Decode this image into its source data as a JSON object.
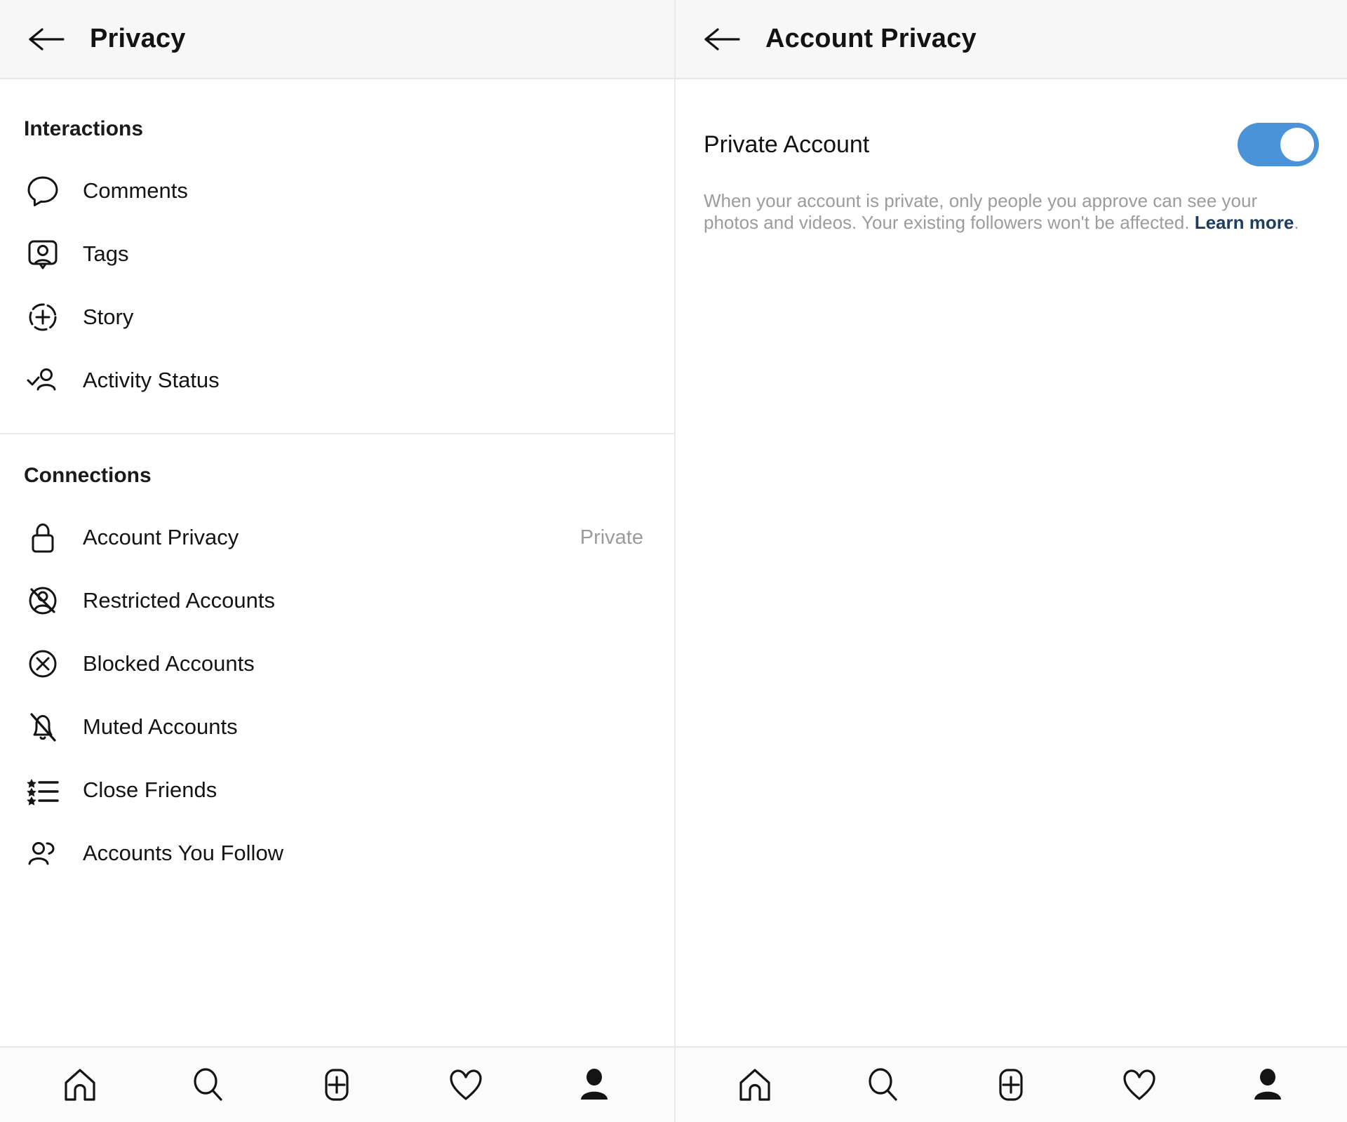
{
  "left_panel": {
    "header": {
      "back_icon": "arrow-left-icon",
      "title": "Privacy"
    },
    "sections": [
      {
        "id": "interactions",
        "title": "Interactions",
        "items": [
          {
            "icon": "comment-bubble-icon",
            "label": "Comments",
            "value": ""
          },
          {
            "icon": "tag-person-icon",
            "label": "Tags",
            "value": ""
          },
          {
            "icon": "story-plus-circle-icon",
            "label": "Story",
            "value": ""
          },
          {
            "icon": "activity-status-person-check-icon",
            "label": "Activity Status",
            "value": ""
          }
        ]
      },
      {
        "id": "connections",
        "title": "Connections",
        "items": [
          {
            "icon": "lock-icon",
            "label": "Account Privacy",
            "value": "Private"
          },
          {
            "icon": "restricted-account-icon",
            "label": "Restricted Accounts",
            "value": ""
          },
          {
            "icon": "blocked-circle-x-icon",
            "label": "Blocked Accounts",
            "value": ""
          },
          {
            "icon": "muted-bell-slash-icon",
            "label": "Muted Accounts",
            "value": ""
          },
          {
            "icon": "close-friends-star-list-icon",
            "label": "Close Friends",
            "value": ""
          },
          {
            "icon": "accounts-you-follow-people-icon",
            "label": "Accounts You Follow",
            "value": ""
          }
        ]
      }
    ]
  },
  "right_panel": {
    "header": {
      "back_icon": "arrow-left-icon",
      "title": "Account Privacy"
    },
    "private_account": {
      "label": "Private Account",
      "toggle_state": "on",
      "toggle_color": "#4a93d9",
      "description_text": "When your account is private, only people you approve can see your photos and videos. Your existing followers won't be affected. ",
      "description_link": "Learn more",
      "description_suffix": "."
    }
  },
  "bottom_nav": {
    "items": [
      {
        "icon": "home-icon",
        "label": "Home"
      },
      {
        "icon": "search-icon",
        "label": "Search"
      },
      {
        "icon": "add-post-plus-icon",
        "label": "Add"
      },
      {
        "icon": "heart-activity-icon",
        "label": "Activity"
      },
      {
        "icon": "profile-person-icon",
        "label": "Profile"
      }
    ]
  },
  "colors": {
    "accent_blue": "#4a93d9",
    "link_blue": "#1b3e63",
    "muted_gray": "#9b9b9b",
    "text_black": "#141414",
    "header_bg": "#f7f7f8"
  }
}
